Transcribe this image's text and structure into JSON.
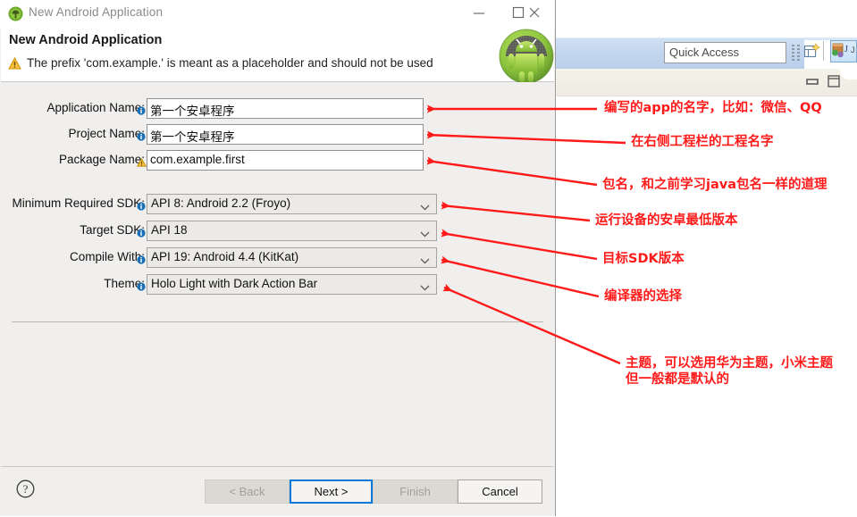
{
  "background_window": {
    "name": "eclipse-ide",
    "quick_access": {
      "placeholder": "Quick Access",
      "value": "Quick Access"
    },
    "window_controls": {
      "minimize": "–",
      "restore": "❐"
    },
    "view_controls": {
      "minimize": "▬",
      "maximize": "❐"
    }
  },
  "dialog": {
    "titlebar": {
      "title": "New Android Application",
      "icon": "android-head-icon",
      "minimize": "–",
      "maximize": "☐",
      "close": "✕"
    },
    "header": {
      "heading": "New Android Application",
      "warning_icon": "warning-triangle-icon",
      "message": "The prefix 'com.example.' is meant as a placeholder and should not be used",
      "logo": "android-robot-logo"
    },
    "fields": [
      {
        "label": "Application Name:",
        "hint_icon": "info-icon",
        "value": "第一个安卓程序",
        "type": "text"
      },
      {
        "label": "Project Name:",
        "hint_icon": "info-icon",
        "value": "第一个安卓程序",
        "type": "text"
      },
      {
        "label": "Package Name:",
        "hint_icon": "warning-icon",
        "value": "com.example.first",
        "type": "text"
      },
      {
        "label": "Minimum Required SDK:",
        "hint_icon": "info-icon",
        "value": "API 8: Android 2.2 (Froyo)",
        "type": "combo"
      },
      {
        "label": "Target SDK:",
        "hint_icon": "info-icon",
        "value": "API 18",
        "type": "combo"
      },
      {
        "label": "Compile With:",
        "hint_icon": "info-icon",
        "value": "API 19: Android 4.4 (KitKat)",
        "type": "combo"
      },
      {
        "label": "Theme:",
        "hint_icon": "info-icon",
        "value": "Holo Light with Dark Action Bar",
        "type": "combo"
      }
    ],
    "footer": {
      "help_icon": "question-mark-icon",
      "back": "< Back",
      "next": "Next >",
      "finish": "Finish",
      "cancel": "Cancel"
    }
  },
  "annotations": {
    "color": "#ff1a1a",
    "items": [
      {
        "id": "app-name-note",
        "text": "编写的app的名字，比如：微信、QQ"
      },
      {
        "id": "project-name-note",
        "text": "在右侧工程栏的工程名字"
      },
      {
        "id": "package-name-note",
        "text": "包名，和之前学习java包名一样的道理"
      },
      {
        "id": "min-sdk-note",
        "text": "运行设备的安卓最低版本"
      },
      {
        "id": "target-sdk-note",
        "text": "目标SDK版本"
      },
      {
        "id": "compile-with-note",
        "text": "编译器的选择"
      },
      {
        "id": "theme-note-line1",
        "text": "主题，可以选用华为主题，小米主题"
      },
      {
        "id": "theme-note-line2",
        "text": "但一般都是默认的"
      }
    ]
  }
}
